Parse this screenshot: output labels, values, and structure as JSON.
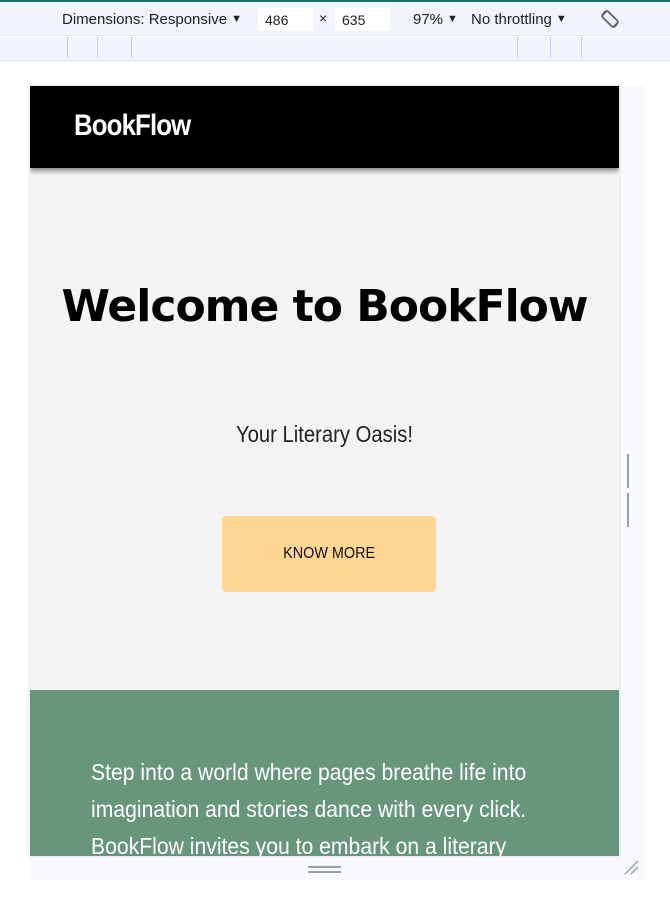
{
  "devtools": {
    "dimensions_label": "Dimensions: Responsive",
    "width_value": "486",
    "times_glyph": "×",
    "height_value": "635",
    "zoom": "97%",
    "throttling": "No throttling",
    "accent_color": "#1f6e6a"
  },
  "site": {
    "logo": "BookFlow",
    "hero": {
      "title": "Welcome to BookFlow",
      "subtitle": "Your Literary Oasis!",
      "cta_label": "KNOW MORE",
      "cta_color": "#ffd692"
    },
    "about": {
      "text": "Step into a world where pages breathe life into imagination and stories dance with every click. BookFlow invites you to embark on a literary",
      "background": "#67967d"
    }
  }
}
